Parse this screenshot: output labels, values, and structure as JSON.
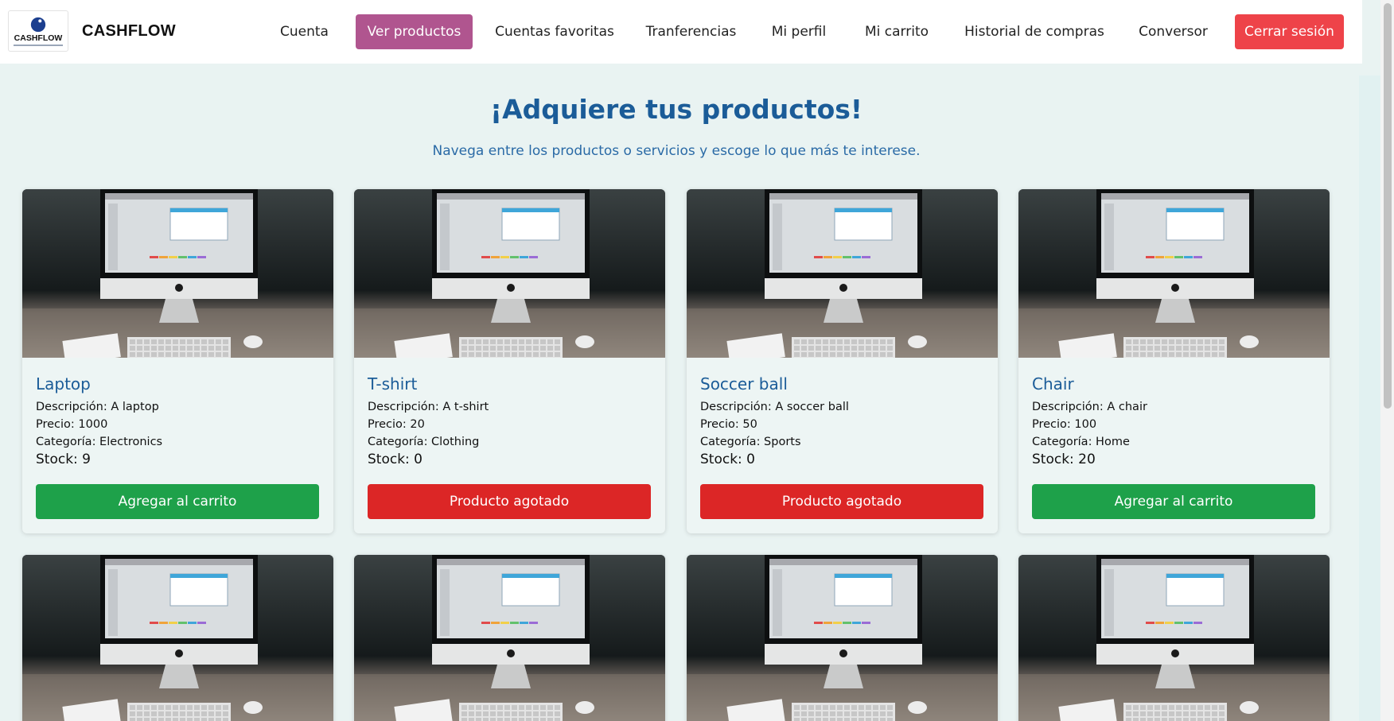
{
  "brand": {
    "logo_text": "CASHFLOW",
    "name": "CASHFLOW"
  },
  "nav": [
    {
      "label": "Cuenta",
      "state": "default"
    },
    {
      "label": "Ver productos",
      "state": "active"
    },
    {
      "label": "Cuentas favoritas",
      "state": "default"
    },
    {
      "label": "Tranferencias",
      "state": "default"
    },
    {
      "label": "Mi perfil",
      "state": "default"
    },
    {
      "label": "Mi carrito",
      "state": "default"
    },
    {
      "label": "Historial de compras",
      "state": "default"
    },
    {
      "label": "Conversor",
      "state": "default"
    },
    {
      "label": "Cerrar sesión",
      "state": "danger"
    }
  ],
  "header": {
    "title": "¡Adquiere tus productos!",
    "subtitle": "Navega entre los productos o servicios y escoge lo que más te interese."
  },
  "products": [
    {
      "name": "Laptop",
      "description": "Descripción: A laptop",
      "price": "Precio: 1000",
      "category": "Categoría: Electronics",
      "stock": "Stock: 9",
      "button": "Agregar al carrito",
      "available": true
    },
    {
      "name": "T-shirt",
      "description": "Descripción: A t-shirt",
      "price": "Precio: 20",
      "category": "Categoría: Clothing",
      "stock": "Stock: 0",
      "button": "Producto agotado",
      "available": false
    },
    {
      "name": "Soccer ball",
      "description": "Descripción: A soccer ball",
      "price": "Precio: 50",
      "category": "Categoría: Sports",
      "stock": "Stock: 0",
      "button": "Producto agotado",
      "available": false
    },
    {
      "name": "Chair",
      "description": "Descripción: A chair",
      "price": "Precio: 100",
      "category": "Categoría: Home",
      "stock": "Stock: 20",
      "button": "Agregar al carrito",
      "available": true
    }
  ],
  "colors": {
    "page_bg": "#e9f3f2",
    "title": "#1b5c98",
    "active_nav": "#b0558f",
    "logout": "#ee4349",
    "add_button": "#1ea14a",
    "soldout_button": "#dc2626"
  }
}
